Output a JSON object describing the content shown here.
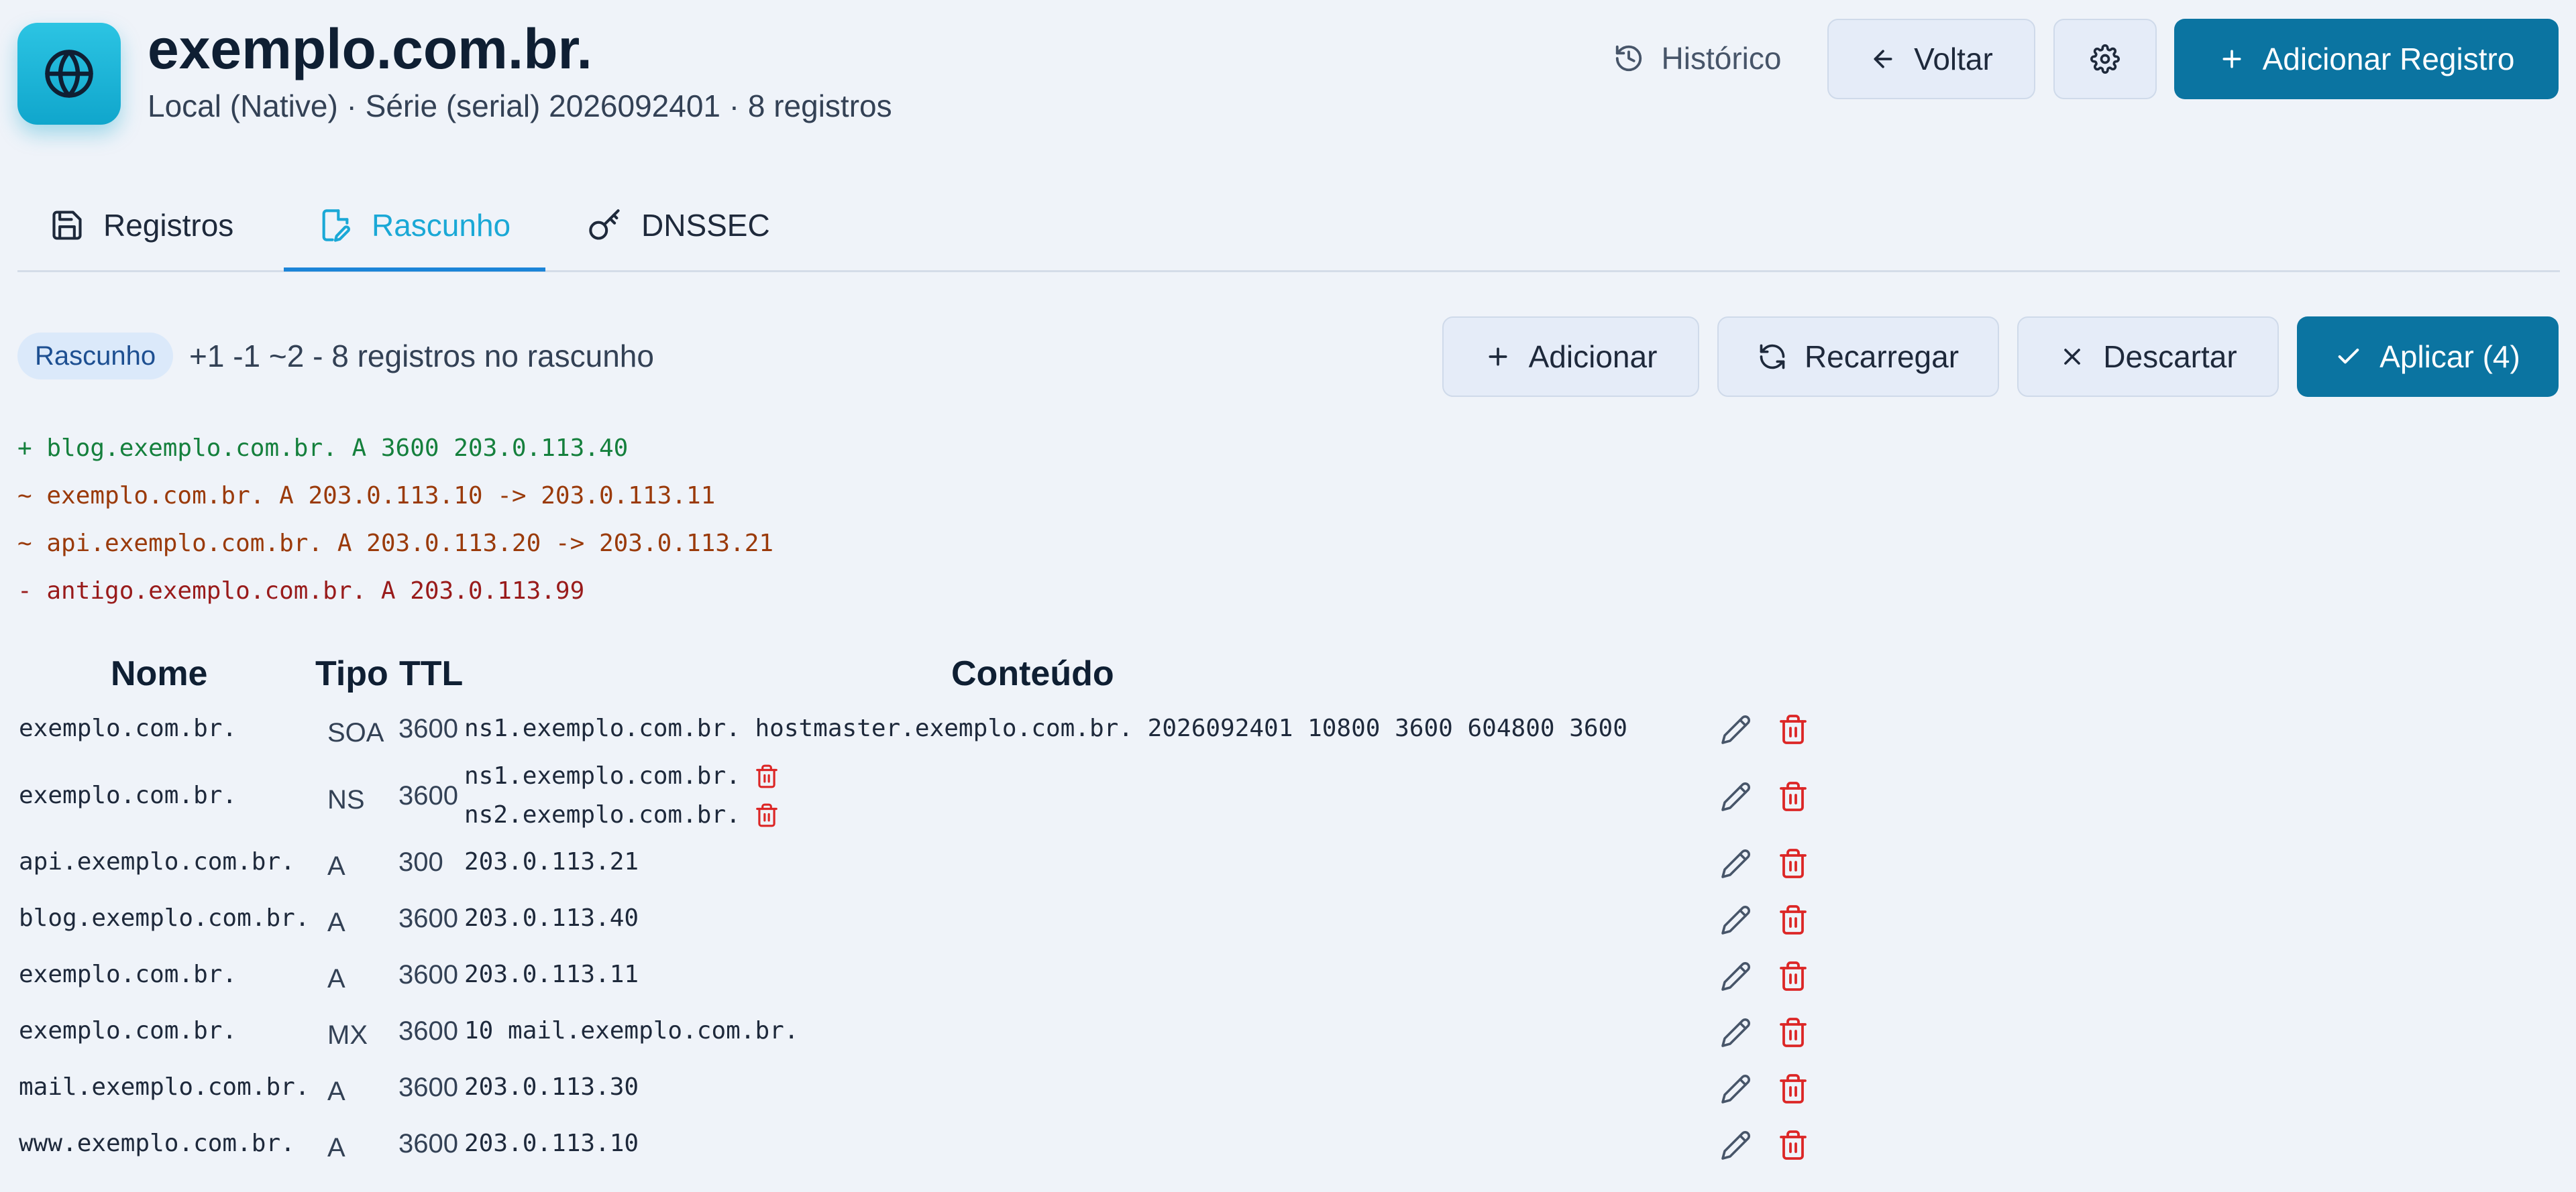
{
  "header": {
    "title": "exemplo.com.br.",
    "subtitle": "Local (Native) · Série (serial) 2026092401 · 8 registros",
    "history_label": "Histórico",
    "back_label": "Voltar",
    "add_record_label": "Adicionar Registro"
  },
  "tabs": [
    {
      "label": "Registros",
      "icon": "save-icon"
    },
    {
      "label": "Rascunho",
      "icon": "draft-icon",
      "active": true
    },
    {
      "label": "DNSSEC",
      "icon": "key-icon"
    }
  ],
  "draft": {
    "badge": "Rascunho",
    "summary": "+1 -1 ~2 - 8 registros no rascunho",
    "add_label": "Adicionar",
    "reload_label": "Recarregar",
    "discard_label": "Descartar",
    "apply_label": "Aplicar (4)"
  },
  "diff": [
    {
      "text": "+ blog.exemplo.com.br. A 3600 203.0.113.40",
      "kind": "added",
      "color": "#15803d"
    },
    {
      "text": "~ exemplo.com.br. A 203.0.113.10 -> 203.0.113.11",
      "kind": "modified",
      "color": "#9a3a0a"
    },
    {
      "text": "~ api.exemplo.com.br. A 203.0.113.20 -> 203.0.113.21",
      "kind": "modified",
      "color": "#9a3a0a"
    },
    {
      "text": "- antigo.exemplo.com.br. A 203.0.113.99",
      "kind": "removed",
      "color": "#991b1b"
    }
  ],
  "table": {
    "headers": {
      "name": "Nome",
      "type": "Tipo",
      "ttl": "TTL",
      "content": "Conteúdo"
    },
    "rows": [
      {
        "name": "exemplo.com.br.",
        "type": "SOA",
        "ttl": "3600",
        "content": [
          "ns1.exemplo.com.br. hostmaster.exemplo.com.br. 2026092401 10800 3600 604800 3600"
        ]
      },
      {
        "name": "exemplo.com.br.",
        "type": "NS",
        "ttl": "3600",
        "content": [
          "ns1.exemplo.com.br.",
          "ns2.exemplo.com.br."
        ]
      },
      {
        "name": "api.exemplo.com.br.",
        "type": "A",
        "ttl": "300",
        "content": [
          "203.0.113.21"
        ]
      },
      {
        "name": "blog.exemplo.com.br.",
        "type": "A",
        "ttl": "3600",
        "content": [
          "203.0.113.40"
        ]
      },
      {
        "name": "exemplo.com.br.",
        "type": "A",
        "ttl": "3600",
        "content": [
          "203.0.113.11"
        ]
      },
      {
        "name": "exemplo.com.br.",
        "type": "MX",
        "ttl": "3600",
        "content": [
          "10 mail.exemplo.com.br."
        ]
      },
      {
        "name": "mail.exemplo.com.br.",
        "type": "A",
        "ttl": "3600",
        "content": [
          "203.0.113.30"
        ]
      },
      {
        "name": "www.exemplo.com.br.",
        "type": "A",
        "ttl": "3600",
        "content": [
          "203.0.113.10"
        ]
      }
    ]
  },
  "colors": {
    "accent": "#0b74a1",
    "active_tab": "#1aa8d6",
    "delete": "#dc2626",
    "edit": "#475569"
  }
}
